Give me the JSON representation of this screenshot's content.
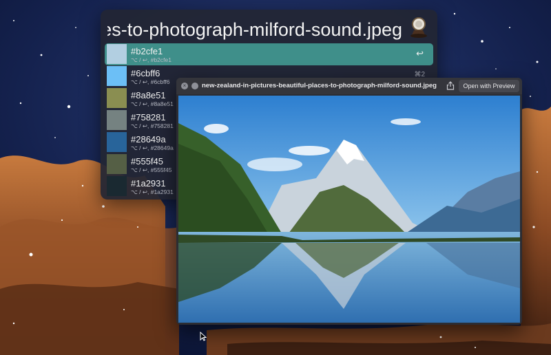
{
  "launcher": {
    "query": "new-zealand-in-pictures-beautiful-places-to-photograph-milford-sound.jpeg",
    "items": [
      {
        "hex": "#b2cfe1",
        "sub": "⌥ / ↩, #b2cfe1",
        "color": "#b2cfe1",
        "shortcut": "↩"
      },
      {
        "hex": "#6cbff6",
        "sub": "⌥ / ↩, #6cbff6",
        "color": "#6cbff6",
        "shortcut": "⌘2"
      },
      {
        "hex": "#8a8e51",
        "sub": "⌥ / ↩, #8a8e51",
        "color": "#8a8e51",
        "shortcut": ""
      },
      {
        "hex": "#758281",
        "sub": "⌥ / ↩, #758281",
        "color": "#758281",
        "shortcut": ""
      },
      {
        "hex": "#28649a",
        "sub": "⌥ / ↩, #28649a",
        "color": "#28649a",
        "shortcut": ""
      },
      {
        "hex": "#555f45",
        "sub": "⌥ / ↩, #555f45",
        "color": "#555f45",
        "shortcut": ""
      },
      {
        "hex": "#1a2931",
        "sub": "⌥ / ↩, #1a2931",
        "color": "#1a2931",
        "shortcut": ""
      }
    ]
  },
  "preview": {
    "title": "new-zealand-in-pictures-beautiful-places-to-photograph-milford-sound.jpeg",
    "open_button": "Open with Preview"
  },
  "colors": {
    "selected_row": "#3f8f8a",
    "panel": "#222634"
  }
}
